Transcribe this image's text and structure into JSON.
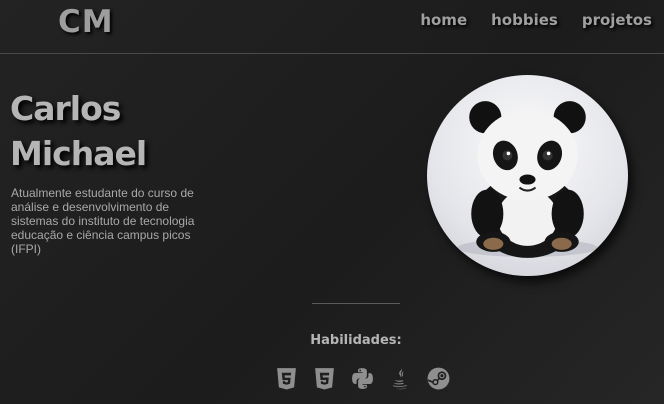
{
  "header": {
    "logo": "CM",
    "nav": [
      {
        "label": "home"
      },
      {
        "label": "hobbies"
      },
      {
        "label": "projetos"
      }
    ]
  },
  "hero": {
    "name_line1": "Carlos",
    "name_line2": "Michael",
    "description": "Atualmente estudante do curso de análise e desenvolvimento de sistemas do instituto de tecnologia educação e ciência campus picos (IFPI)"
  },
  "skills": {
    "title": "Habilidades:",
    "icons": [
      "html5-icon",
      "css3-icon",
      "python-icon",
      "java-icon",
      "steam-icon"
    ]
  },
  "colors": {
    "background": "#1f1f1f",
    "text": "#b5b5b5",
    "icon": "#8f8f8f"
  }
}
